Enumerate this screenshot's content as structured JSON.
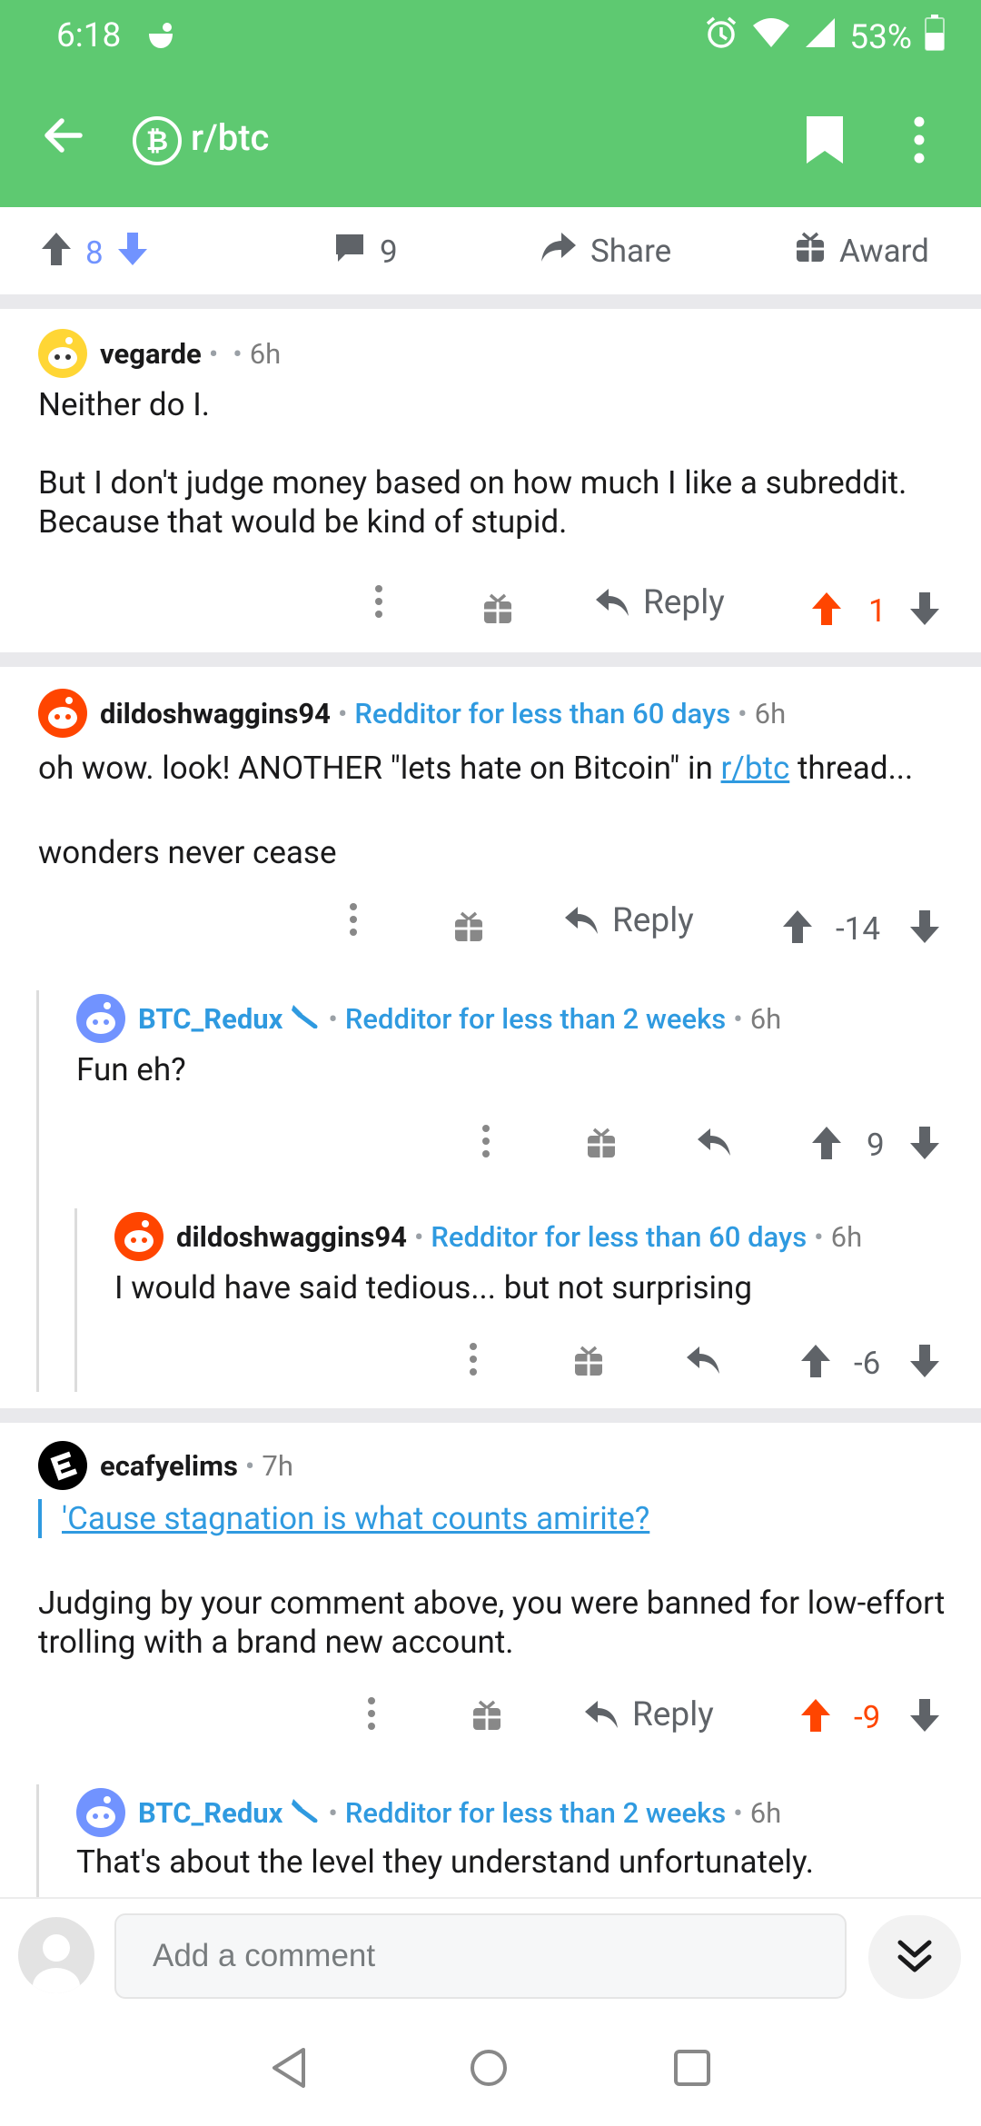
{
  "status_bar": {
    "time": "6:18",
    "battery": "53%"
  },
  "app_bar": {
    "subreddit": "r/btc",
    "sub_icon_glyph": "₿"
  },
  "post_actions": {
    "score": "8",
    "comments": "9",
    "share": "Share",
    "award": "Award"
  },
  "comments": [
    {
      "author": "vegarde",
      "time": "6h",
      "body_1": "Neither do I.",
      "body_2": "But I don't judge money  based on how much I like a subreddit. Because that would be kind of stupid.",
      "reply": "Reply",
      "score": "1"
    },
    {
      "author": "dildoshwaggins94",
      "flair": "Redditor for less than 60 days",
      "time": "6h",
      "body_1_pre": "oh wow. look! ANOTHER \"lets hate on Bitcoin\" in ",
      "body_1_link": "r/btc",
      "body_1_post": " thread...",
      "body_2": "wonders never cease",
      "reply": "Reply",
      "score": "-14"
    },
    {
      "author": "BTC_Redux",
      "flair": "Redditor for less than 2 weeks",
      "time": "6h",
      "body": "Fun eh?",
      "score": "9"
    },
    {
      "author": "dildoshwaggins94",
      "flair": "Redditor for less than 60 days",
      "time": "6h",
      "body": "I would have said tedious... but not surprising",
      "score": "-6"
    },
    {
      "author": "ecafyelims",
      "time": "7h",
      "quote": "'Cause stagnation is what counts amirite?",
      "body": "Judging by your comment above, you were banned for low-effort trolling with a brand new account.",
      "reply": "Reply",
      "score": "-9"
    },
    {
      "author": "BTC_Redux",
      "flair": "Redditor for less than 2 weeks",
      "time": "6h",
      "body": "That's about the level they understand unfortunately."
    }
  ],
  "bottom": {
    "placeholder": "Add a comment"
  },
  "colors": {
    "header": "#5ec971",
    "upvote": "#ff4500",
    "link": "#2f9ae0",
    "downvote": "#7193ff"
  }
}
